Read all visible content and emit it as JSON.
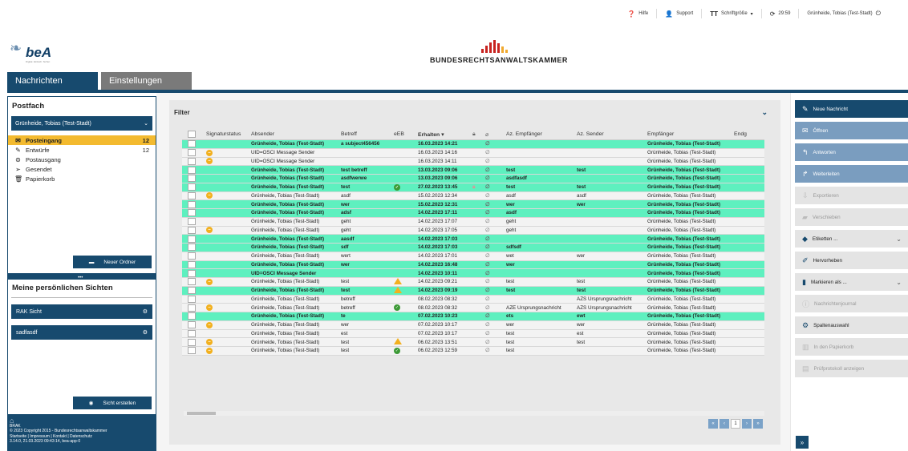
{
  "topbar": {
    "help": "Hilfe",
    "support": "Support",
    "font_size": "Schriftgröße",
    "timer": "29:59",
    "user": "Grünheide, Tobias (Test-Stadt)"
  },
  "logo": {
    "bea_word": "beA",
    "bea_sub": "Digital. Einfach. Sicher.",
    "brak_name": "BUNDESRECHTSANWALTSKAMMER"
  },
  "tabs": [
    {
      "label": "Nachrichten"
    },
    {
      "label": "Einstellungen"
    }
  ],
  "sidebar": {
    "postfach_title": "Postfach",
    "account": "Grünheide, Tobias (Test-Stadt)",
    "folders": [
      {
        "label": "Posteingang",
        "count": "12",
        "icon": "inbox-icon"
      },
      {
        "label": "Entwürfe",
        "count": "12",
        "icon": "drafts-icon"
      },
      {
        "label": "Postausgang",
        "count": "",
        "icon": "outbox-icon"
      },
      {
        "label": "Gesendet",
        "count": "",
        "icon": "sent-icon"
      },
      {
        "label": "Papierkorb",
        "count": "",
        "icon": "trash-icon"
      }
    ],
    "new_folder": "Neuer Ordner",
    "views_title": "Meine persönlichen Sichten",
    "views": [
      {
        "label": "RAK Sicht"
      },
      {
        "label": "sadfasdf"
      }
    ],
    "create_view": "Sicht erstellen",
    "footer_brand": "BRAK",
    "footer_copyright": "© 2023 Copyright 2015 - Bundesrechtsanwaltskammer",
    "footer_links": "Startseite | Impressum | Kontakt | Datenschutz",
    "footer_version": "3.14.0, 21.03.2023 09:43:14, bea-app-0"
  },
  "main": {
    "filter_label": "Filter",
    "columns": [
      "Signaturstatus",
      "Absender",
      "Betreff",
      "eEB",
      "Erhalten",
      "",
      "",
      "Az. Empfänger",
      "Az. Sender",
      "Empfänger",
      "Endg"
    ],
    "rows": [
      {
        "unread": true,
        "sig": "",
        "abs": "Grünheide, Tobias (Test-Stadt)",
        "bet": "a subject456456",
        "eeb": "",
        "erh": "16.03.2023 14:21",
        "lock": false,
        "aze": "",
        "azs": "",
        "emp": "Grünheide, Tobias (Test-Stadt)"
      },
      {
        "unread": false,
        "sig": "warn",
        "abs": "UID=OSCI Message Sender",
        "bet": "",
        "eeb": "",
        "erh": "16.03.2023 14:16",
        "lock": false,
        "aze": "",
        "azs": "",
        "emp": "Grünheide, Tobias (Test-Stadt)"
      },
      {
        "unread": false,
        "sig": "warn",
        "abs": "UID=OSCI Message Sender",
        "bet": "",
        "eeb": "",
        "erh": "16.03.2023 14:11",
        "lock": false,
        "aze": "",
        "azs": "",
        "emp": "Grünheide, Tobias (Test-Stadt)"
      },
      {
        "unread": true,
        "sig": "",
        "abs": "Grünheide, Tobias (Test-Stadt)",
        "bet": "test betreff",
        "eeb": "",
        "erh": "13.03.2023 09:06",
        "lock": false,
        "aze": "test",
        "azs": "test",
        "emp": "Grünheide, Tobias (Test-Stadt)"
      },
      {
        "unread": true,
        "sig": "",
        "abs": "Grünheide, Tobias (Test-Stadt)",
        "bet": "asdfwerwe",
        "eeb": "",
        "erh": "13.03.2023 09:06",
        "lock": false,
        "aze": "asdfasdf",
        "azs": "",
        "emp": "Grünheide, Tobias (Test-Stadt)"
      },
      {
        "unread": true,
        "sig": "",
        "abs": "Grünheide, Tobias (Test-Stadt)",
        "bet": "test",
        "eeb": "ok",
        "erh": "27.02.2023 13:45",
        "lock": true,
        "aze": "test",
        "azs": "test",
        "emp": "Grünheide, Tobias (Test-Stadt)"
      },
      {
        "unread": false,
        "sig": "warn",
        "abs": "Grünheide, Tobias (Test-Stadt)",
        "bet": "asdf",
        "eeb": "",
        "erh": "15.02.2023 12:34",
        "lock": false,
        "aze": "asdf",
        "azs": "asdf",
        "emp": "Grünheide, Tobias (Test-Stadt)"
      },
      {
        "unread": true,
        "sig": "",
        "abs": "Grünheide, Tobias (Test-Stadt)",
        "bet": "wer",
        "eeb": "",
        "erh": "15.02.2023 12:31",
        "lock": false,
        "aze": "wer",
        "azs": "wer",
        "emp": "Grünheide, Tobias (Test-Stadt)"
      },
      {
        "unread": true,
        "sig": "",
        "abs": "Grünheide, Tobias (Test-Stadt)",
        "bet": "adsf",
        "eeb": "",
        "erh": "14.02.2023 17:11",
        "lock": false,
        "aze": "asdf",
        "azs": "",
        "emp": "Grünheide, Tobias (Test-Stadt)"
      },
      {
        "unread": false,
        "sig": "",
        "abs": "Grünheide, Tobias (Test-Stadt)",
        "bet": "geht",
        "eeb": "",
        "erh": "14.02.2023 17:07",
        "lock": false,
        "aze": "geht",
        "azs": "",
        "emp": "Grünheide, Tobias (Test-Stadt)"
      },
      {
        "unread": false,
        "sig": "warn",
        "abs": "Grünheide, Tobias (Test-Stadt)",
        "bet": "geht",
        "eeb": "",
        "erh": "14.02.2023 17:05",
        "lock": false,
        "aze": "geht",
        "azs": "",
        "emp": "Grünheide, Tobias (Test-Stadt)"
      },
      {
        "unread": true,
        "sig": "",
        "abs": "Grünheide, Tobias (Test-Stadt)",
        "bet": "aasdf",
        "eeb": "",
        "erh": "14.02.2023 17:03",
        "lock": false,
        "aze": "",
        "azs": "",
        "emp": "Grünheide, Tobias (Test-Stadt)"
      },
      {
        "unread": true,
        "sig": "",
        "abs": "Grünheide, Tobias (Test-Stadt)",
        "bet": "sdf",
        "eeb": "",
        "erh": "14.02.2023 17:03",
        "lock": false,
        "aze": "sdfsdf",
        "azs": "",
        "emp": "Grünheide, Tobias (Test-Stadt)"
      },
      {
        "unread": false,
        "sig": "",
        "abs": "Grünheide, Tobias (Test-Stadt)",
        "bet": "wert",
        "eeb": "",
        "erh": "14.02.2023 17:01",
        "lock": false,
        "aze": "wet",
        "azs": "wer",
        "emp": "Grünheide, Tobias (Test-Stadt)"
      },
      {
        "unread": true,
        "sig": "",
        "abs": "Grünheide, Tobias (Test-Stadt)",
        "bet": "wer",
        "eeb": "",
        "erh": "14.02.2023 16:48",
        "lock": false,
        "aze": "wer",
        "azs": "",
        "emp": "Grünheide, Tobias (Test-Stadt)"
      },
      {
        "unread": true,
        "sig": "",
        "abs": "UID=OSCI Message Sender",
        "bet": "",
        "eeb": "",
        "erh": "14.02.2023 10:11",
        "lock": false,
        "aze": "",
        "azs": "",
        "emp": "Grünheide, Tobias (Test-Stadt)"
      },
      {
        "unread": false,
        "sig": "warn",
        "abs": "Grünheide, Tobias (Test-Stadt)",
        "bet": "test",
        "eeb": "warn",
        "erh": "14.02.2023 09:21",
        "lock": false,
        "aze": "test",
        "azs": "test",
        "emp": "Grünheide, Tobias (Test-Stadt)"
      },
      {
        "unread": true,
        "sig": "",
        "abs": "Grünheide, Tobias (Test-Stadt)",
        "bet": "test",
        "eeb": "warn",
        "erh": "14.02.2023 09:19",
        "lock": false,
        "aze": "test",
        "azs": "test",
        "emp": "Grünheide, Tobias (Test-Stadt)"
      },
      {
        "unread": false,
        "sig": "",
        "abs": "Grünheide, Tobias (Test-Stadt)",
        "bet": "betreff",
        "eeb": "",
        "erh": "08.02.2023 08:32",
        "lock": false,
        "aze": "",
        "azs": "AZS Ursprungsnachricht",
        "emp": "Grünheide, Tobias (Test-Stadt)"
      },
      {
        "unread": false,
        "sig": "warn",
        "abs": "Grünheide, Tobias (Test-Stadt)",
        "bet": "betreff",
        "eeb": "ok",
        "erh": "08.02.2023 08:32",
        "lock": false,
        "aze": "AZE Ursprungsnachricht",
        "azs": "AZS Ursprungsnachricht",
        "emp": "Grünheide, Tobias (Test-Stadt)"
      },
      {
        "unread": true,
        "sig": "",
        "abs": "Grünheide, Tobias (Test-Stadt)",
        "bet": "te",
        "eeb": "",
        "erh": "07.02.2023 10:23",
        "lock": false,
        "aze": "ets",
        "azs": "ewt",
        "emp": "Grünheide, Tobias (Test-Stadt)"
      },
      {
        "unread": false,
        "sig": "warn",
        "abs": "Grünheide, Tobias (Test-Stadt)",
        "bet": "wer",
        "eeb": "",
        "erh": "07.02.2023 10:17",
        "lock": false,
        "aze": "wer",
        "azs": "wer",
        "emp": "Grünheide, Tobias (Test-Stadt)"
      },
      {
        "unread": false,
        "sig": "",
        "abs": "Grünheide, Tobias (Test-Stadt)",
        "bet": "est",
        "eeb": "",
        "erh": "07.02.2023 10:17",
        "lock": false,
        "aze": "test",
        "azs": "est",
        "emp": "Grünheide, Tobias (Test-Stadt)"
      },
      {
        "unread": false,
        "sig": "warn",
        "abs": "Grünheide, Tobias (Test-Stadt)",
        "bet": "test",
        "eeb": "warn",
        "erh": "06.02.2023 13:51",
        "lock": false,
        "aze": "test",
        "azs": "test",
        "emp": "Grünheide, Tobias (Test-Stadt)"
      },
      {
        "unread": false,
        "sig": "warn",
        "abs": "Grünheide, Tobias (Test-Stadt)",
        "bet": "test",
        "eeb": "ok",
        "erh": "06.02.2023 12:59",
        "lock": false,
        "aze": "test",
        "azs": "",
        "emp": "Grünheide, Tobias (Test-Stadt)"
      }
    ],
    "pager": [
      "«",
      "‹",
      "1",
      "›",
      "»"
    ]
  },
  "actions": [
    {
      "label": "Neue Nachricht",
      "style": "primary",
      "icon": "pencil-icon",
      "glyph": "✎",
      "chev": false
    },
    {
      "label": "Öffnen",
      "style": "mid",
      "icon": "envelope-icon",
      "glyph": "✉",
      "chev": false
    },
    {
      "label": "Antworten",
      "style": "mid",
      "icon": "reply-icon",
      "glyph": "↰",
      "chev": false
    },
    {
      "label": "Weiterleiten",
      "style": "mid",
      "icon": "forward-icon",
      "glyph": "↱",
      "chev": false
    },
    {
      "label": "Exportieren",
      "style": "light",
      "icon": "export-icon",
      "glyph": "⇩",
      "chev": false
    },
    {
      "label": "Verschieben",
      "style": "light",
      "icon": "folder-move-icon",
      "glyph": "▰",
      "chev": false
    },
    {
      "label": "Etiketten ...",
      "style": "gray",
      "icon": "tags-icon",
      "glyph": "◆",
      "chev": true
    },
    {
      "label": "Hervorheben",
      "style": "gray",
      "icon": "highlight-pen-icon",
      "glyph": "✐",
      "chev": false
    },
    {
      "label": "Markieren als ...",
      "style": "gray",
      "icon": "bookmark-icon",
      "glyph": "▮",
      "chev": true
    },
    {
      "label": "Nachrichtenjournal",
      "style": "light",
      "icon": "info-icon",
      "glyph": "ⓘ",
      "chev": false
    },
    {
      "label": "Spaltenauswahl",
      "style": "gray",
      "icon": "cog-icon",
      "glyph": "⚙",
      "chev": false
    },
    {
      "label": "In den Papierkorb",
      "style": "light",
      "icon": "trash-icon",
      "glyph": "▥",
      "chev": false
    },
    {
      "label": "Prüfprotokoll anzeigen",
      "style": "light",
      "icon": "file-icon",
      "glyph": "▤",
      "chev": false
    }
  ],
  "expand_label": "»"
}
